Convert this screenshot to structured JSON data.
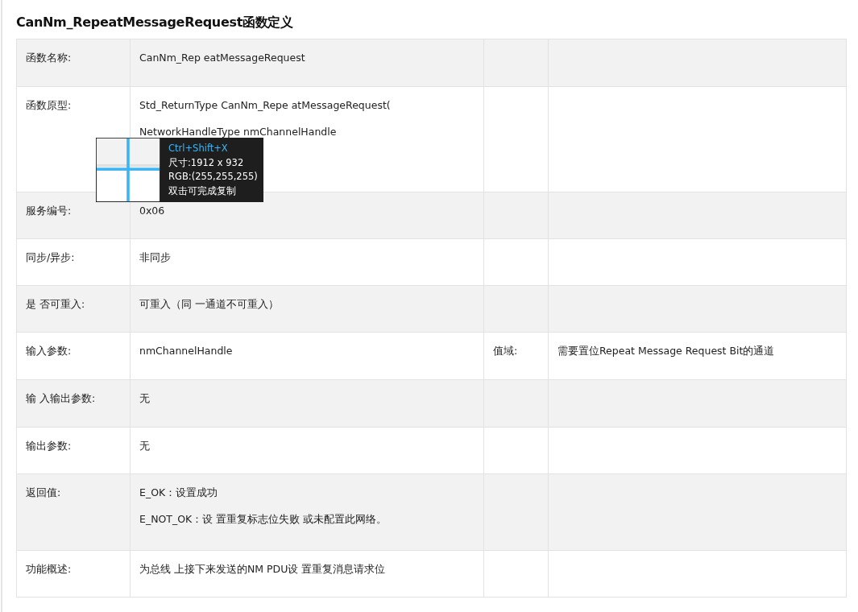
{
  "title": "CanNm_RepeatMessageRequest函数定义",
  "rows": [
    {
      "label": "函数名称:",
      "value": [
        "CanNm_Rep eatMessageRequest"
      ]
    },
    {
      "label": "函数原型:",
      "value": [
        "Std_ReturnType CanNm_Repe atMessageRequest(",
        "NetworkHandleType nmChannelHandle"
      ]
    },
    {
      "label": "服务编号:",
      "value": [
        "0x06"
      ]
    },
    {
      "label": "同步/异步:",
      "value": [
        "非同步"
      ]
    },
    {
      "label": "是 否可重入:",
      "value": [
        "可重入（同 一通道不可重入）"
      ]
    },
    {
      "label": "输入参数:",
      "value": [
        "nmChannelHandle"
      ],
      "extra_label": "值域:",
      "extra_value": "需要置位Repeat Message Request Bit的通道"
    },
    {
      "label": "输 入输出参数:",
      "value": [
        "无"
      ]
    },
    {
      "label": "输出参数:",
      "value": [
        "无"
      ]
    },
    {
      "label": "返回值:",
      "value": [
        "E_OK：设置成功",
        "E_NOT_OK：设 置重复标志位失败 或未配置此网络。"
      ]
    },
    {
      "label": "功能概述:",
      "value": [
        "为总线 上接下来发送的NM PDU设 置重复消息请求位"
      ]
    }
  ],
  "overlay": {
    "shortcut": "Ctrl+Shift+X",
    "lines": [
      "尺寸:1912 x 932",
      "RGB:(255,255,255)",
      "双击可完成复制"
    ]
  }
}
